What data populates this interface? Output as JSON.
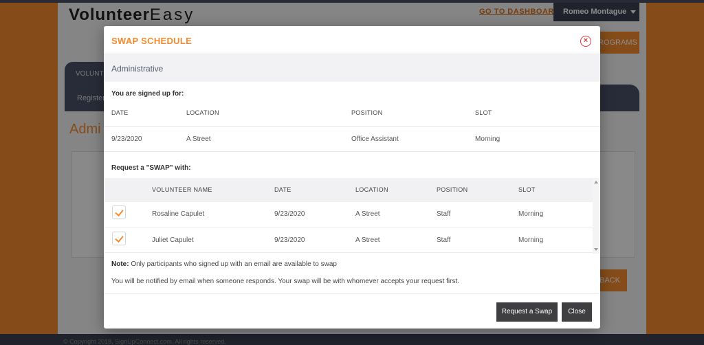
{
  "background": {
    "logo_bold": "Volunteer",
    "logo_light": "Easy",
    "dashboard_link": "GO TO DASHBOARD",
    "user_menu": "Romeo Montague",
    "programs_button": "ROGRAMS",
    "nav_tab": "VOLUNTE",
    "nav_item": "Register",
    "page_heading": "Admi",
    "back_button": "BACK",
    "footer_text": "© Copyright 2018, SignUpConnect.com. All rights reserved."
  },
  "modal": {
    "title": "SWAP SCHEDULE",
    "close_icon": "close-circle-icon",
    "program_name": "Administrative",
    "signed_up_label": "You are signed up for:",
    "signed_up_columns": [
      "DATE",
      "LOCATION",
      "POSITION",
      "SLOT"
    ],
    "signed_up_rows": [
      {
        "date": "9/23/2020",
        "location": "A Street",
        "position": "Office Assistant",
        "slot": "Morning"
      }
    ],
    "request_label": "Request a \"SWAP\" with:",
    "swap_columns": [
      "VOLUNTEER NAME",
      "DATE",
      "LOCATION",
      "POSITION",
      "SLOT"
    ],
    "swap_rows": [
      {
        "checked": true,
        "name": "Rosaline Capulet",
        "date": "9/23/2020",
        "location": "A Street",
        "position": "Staff",
        "slot": "Morning"
      },
      {
        "checked": true,
        "name": "Juliet Capulet",
        "date": "9/23/2020",
        "location": "A Street",
        "position": "Staff",
        "slot": "Morning"
      }
    ],
    "note_label": "Note:",
    "note_text": " Only participants who signed up with an email are available to swap",
    "notify_text": "You will be notified by email when someone responds. Your swap will be with whomever accepts your request first.",
    "request_button": "Request a Swap",
    "close_button": "Close"
  },
  "colors": {
    "accent": "#f28b2e",
    "navy": "#4a5068",
    "button_dark": "#3f3f42",
    "close_red": "#e0393e"
  }
}
